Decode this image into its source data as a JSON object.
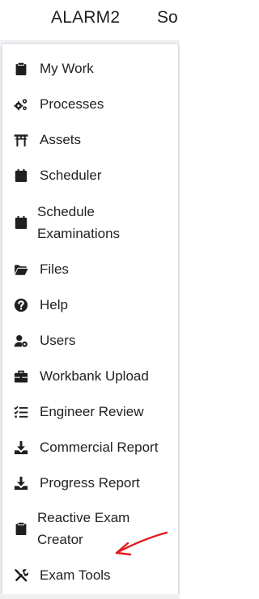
{
  "header": {
    "app_title": "ALARM2",
    "cut_text": "So"
  },
  "menu": {
    "items": [
      {
        "label": "My Work",
        "icon": "clipboard-icon"
      },
      {
        "label": "Processes",
        "icon": "cogs-icon"
      },
      {
        "label": "Assets",
        "icon": "torii-gate-icon"
      },
      {
        "label": "Scheduler",
        "icon": "calendar-icon"
      },
      {
        "label": "Schedule Examinations",
        "icon": "calendar-icon"
      },
      {
        "label": "Files",
        "icon": "folder-open-icon"
      },
      {
        "label": "Help",
        "icon": "question-circle-icon"
      },
      {
        "label": "Users",
        "icon": "user-cog-icon"
      },
      {
        "label": "Workbank Upload",
        "icon": "briefcase-icon"
      },
      {
        "label": "Engineer Review",
        "icon": "list-check-icon"
      },
      {
        "label": "Commercial Report",
        "icon": "download-icon"
      },
      {
        "label": "Progress Report",
        "icon": "download-icon"
      },
      {
        "label": "Reactive Exam Creator",
        "icon": "clipboard-icon"
      },
      {
        "label": "Exam Tools",
        "icon": "tools-icon"
      }
    ]
  },
  "colors": {
    "text": "#222222",
    "icon": "#1f1f1f",
    "annotation": "#e01b1b"
  }
}
